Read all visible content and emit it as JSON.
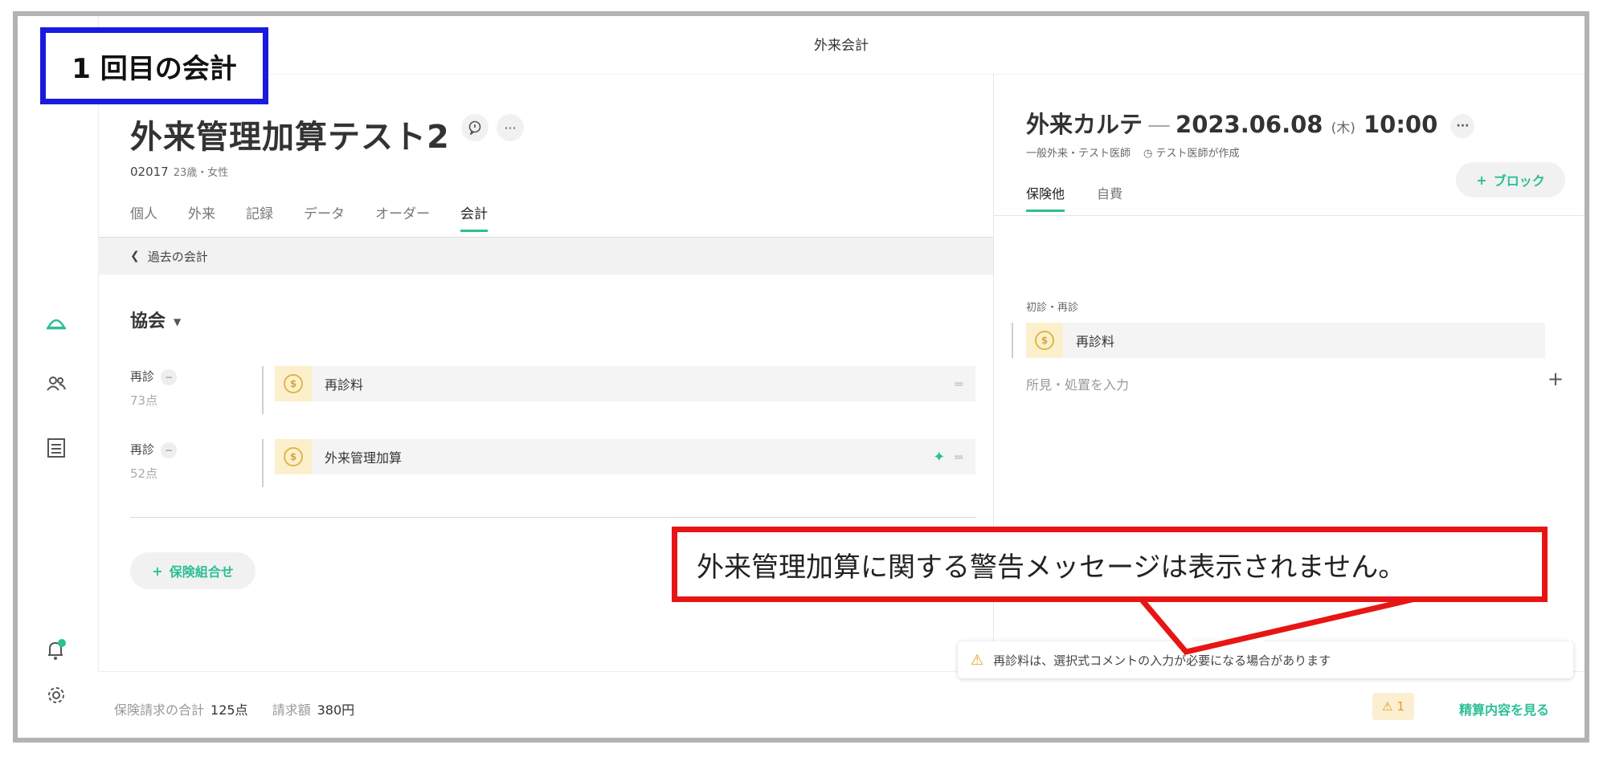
{
  "window": {
    "title": "外来会計"
  },
  "annotation_top": "1 回目の会計",
  "annotation_callout": "外来管理加算に関する警告メッセージは表示されません。",
  "rail": {
    "icons": [
      "home-icon",
      "users-icon",
      "document-list-icon",
      "bell-icon",
      "gear-icon"
    ]
  },
  "patient": {
    "name": "外来管理加算テスト2",
    "id": "02017",
    "age_sex": "23歳・女性"
  },
  "tabs": [
    "個人",
    "外来",
    "記録",
    "データ",
    "オーダー",
    "会計"
  ],
  "active_tab": "会計",
  "back_label": "過去の会計",
  "insurance": {
    "label": "協会"
  },
  "entries": [
    {
      "type": "再診",
      "points": "73点",
      "item": "再診料"
    },
    {
      "type": "再診",
      "points": "52点",
      "item": "外来管理加算"
    }
  ],
  "add_insurance_label": "保険組合せ",
  "karte": {
    "title": "外来カルテ",
    "date": "2023.06.08",
    "dow": "(木)",
    "time": "10:00",
    "dept": "一般外来・テスト医師",
    "author": "テスト医師が作成",
    "block_label": "ブロック",
    "tabs": [
      "保険他",
      "自費"
    ],
    "active_tab": "保険他",
    "section_label": "初診・再診",
    "item": "再診料",
    "placeholder": "所見・処置を入力"
  },
  "toast": {
    "message": "再診料は、選択式コメントの入力が必要になる場合があります"
  },
  "footer": {
    "total_label": "保険請求の合計",
    "total_value": "125点",
    "bill_label": "請求額",
    "bill_value": "380円",
    "warning_count": "1",
    "see_details": "精算内容を見る"
  },
  "colors": {
    "accent": "#2bbf95",
    "warn": "#e39d1a",
    "annot_blue": "#1a1adf",
    "annot_red": "#e81515"
  }
}
